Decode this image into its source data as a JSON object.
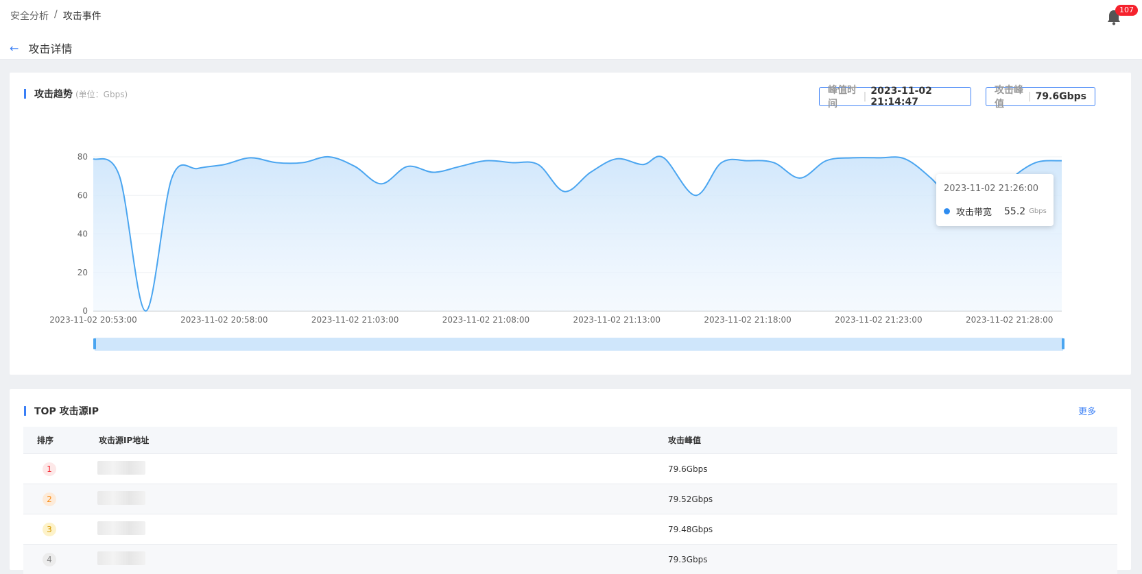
{
  "breadcrumb": {
    "parent": "安全分析",
    "sep": "/",
    "current": "攻击事件"
  },
  "notifications": {
    "count": "107",
    "icon": "bell-icon"
  },
  "header": {
    "back_icon": "arrow-left-icon",
    "title": "攻击详情"
  },
  "trend": {
    "title": "攻击趋势",
    "unit": "(单位：Gbps)",
    "peak_time_label": "峰值时间",
    "peak_time_value": "2023-11-02 21:14:47",
    "peak_value_label": "攻击峰值",
    "peak_value_value": "79.6Gbps"
  },
  "tooltip": {
    "time": "2023-11-02 21:26:00",
    "series": "攻击带宽",
    "value": "55.2",
    "unit": "Gbps"
  },
  "colors": {
    "accent": "#3a7ff6",
    "line": "#4aa5f0",
    "rank1": "#f5222d",
    "rank2": "#fa8c16",
    "rank3": "#e6a700",
    "rank4": "#999999"
  },
  "chart_data": {
    "type": "area",
    "title": "",
    "xlabel": "",
    "ylabel": "",
    "ylim": [
      0,
      80
    ],
    "yticks": [
      "0",
      "20",
      "40",
      "60",
      "80"
    ],
    "xticks": [
      "2023-11-02 20:53:00",
      "2023-11-02 20:58:00",
      "2023-11-02 21:03:00",
      "2023-11-02 21:08:00",
      "2023-11-02 21:13:00",
      "2023-11-02 21:18:00",
      "2023-11-02 21:23:00",
      "2023-11-02 21:28:00"
    ],
    "grid": true,
    "series": [
      {
        "name": "攻击带宽",
        "points": [
          [
            "2023-11-02 20:53:00",
            79
          ],
          [
            "2023-11-02 20:54:00",
            70
          ],
          [
            "2023-11-02 20:55:00",
            0
          ],
          [
            "2023-11-02 20:56:00",
            69
          ],
          [
            "2023-11-02 20:57:00",
            74
          ],
          [
            "2023-11-02 20:58:00",
            76
          ],
          [
            "2023-11-02 20:59:00",
            79.5
          ],
          [
            "2023-11-02 21:00:00",
            77
          ],
          [
            "2023-11-02 21:01:00",
            77
          ],
          [
            "2023-11-02 21:02:00",
            80
          ],
          [
            "2023-11-02 21:03:00",
            75
          ],
          [
            "2023-11-02 21:04:00",
            66
          ],
          [
            "2023-11-02 21:05:00",
            75
          ],
          [
            "2023-11-02 21:06:00",
            72
          ],
          [
            "2023-11-02 21:07:00",
            75
          ],
          [
            "2023-11-02 21:08:00",
            78
          ],
          [
            "2023-11-02 21:09:00",
            77
          ],
          [
            "2023-11-02 21:10:00",
            76
          ],
          [
            "2023-11-02 21:11:00",
            62
          ],
          [
            "2023-11-02 21:12:00",
            72
          ],
          [
            "2023-11-02 21:13:00",
            79
          ],
          [
            "2023-11-02 21:14:00",
            76
          ],
          [
            "2023-11-02 21:14:47",
            79.6
          ],
          [
            "2023-11-02 21:16:00",
            60
          ],
          [
            "2023-11-02 21:17:00",
            77
          ],
          [
            "2023-11-02 21:18:00",
            78
          ],
          [
            "2023-11-02 21:19:00",
            77
          ],
          [
            "2023-11-02 21:20:00",
            69
          ],
          [
            "2023-11-02 21:21:00",
            78
          ],
          [
            "2023-11-02 21:22:00",
            79.5
          ],
          [
            "2023-11-02 21:23:00",
            79.5
          ],
          [
            "2023-11-02 21:24:00",
            79
          ],
          [
            "2023-11-02 21:25:00",
            69
          ],
          [
            "2023-11-02 21:26:00",
            55.2
          ],
          [
            "2023-11-02 21:27:00",
            55
          ],
          [
            "2023-11-02 21:28:00",
            68
          ],
          [
            "2023-11-02 21:29:00",
            77
          ],
          [
            "2023-11-02 21:30:00",
            78
          ]
        ]
      }
    ]
  },
  "top_ips": {
    "title": "TOP 攻击源IP",
    "more": "更多",
    "columns": [
      "排序",
      "攻击源IP地址",
      "攻击峰值"
    ],
    "rows": [
      {
        "rank": "1",
        "peak": "79.6Gbps"
      },
      {
        "rank": "2",
        "peak": "79.52Gbps"
      },
      {
        "rank": "3",
        "peak": "79.48Gbps"
      },
      {
        "rank": "4",
        "peak": "79.3Gbps"
      }
    ]
  }
}
